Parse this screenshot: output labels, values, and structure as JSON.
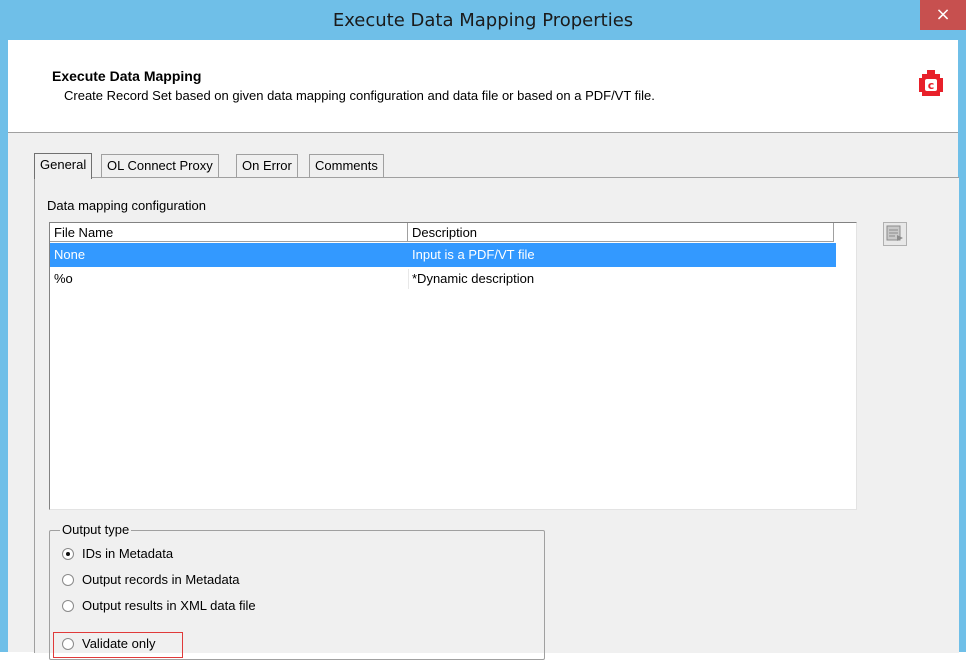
{
  "window": {
    "title": "Execute Data Mapping Properties",
    "close_glyph": "×"
  },
  "header": {
    "title": "Execute Data Mapping",
    "description": "Create Record Set based on given data mapping configuration and data file or based on a PDF/VT file.",
    "logo_icon": "connect-plugin-icon",
    "brand_color": "#e8202a"
  },
  "tabs": [
    {
      "label": "General",
      "active": true
    },
    {
      "label": "OL Connect Proxy",
      "active": false
    },
    {
      "label": "On Error",
      "active": false
    },
    {
      "label": "Comments",
      "active": false
    }
  ],
  "general": {
    "section_label": "Data mapping configuration",
    "columns": [
      "File Name",
      "Description"
    ],
    "rows": [
      {
        "file_name": "None",
        "description": "Input is a PDF/VT file",
        "selected": true
      },
      {
        "file_name": "%o",
        "description": "*Dynamic description",
        "selected": false
      }
    ],
    "side_button_icon": "browse-icon",
    "output_type": {
      "legend": "Output type",
      "options": [
        {
          "label": "IDs in Metadata",
          "checked": true
        },
        {
          "label": "Output records in Metadata",
          "checked": false
        },
        {
          "label": "Output results in XML data file",
          "checked": false
        },
        {
          "label": "Validate only",
          "checked": false
        }
      ]
    }
  },
  "colors": {
    "titlebar": "#6fbfe8",
    "selection": "#3399ff",
    "highlight_border": "#e03a3a",
    "close_button": "#c7504f"
  }
}
